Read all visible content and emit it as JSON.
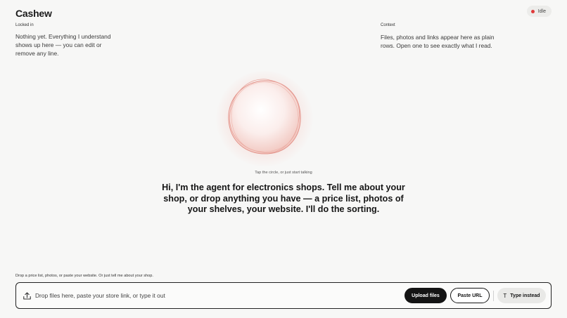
{
  "app": {
    "name": "Cashew"
  },
  "status": {
    "label": "Idle",
    "dot_color": "#e03a3a"
  },
  "locked_in": {
    "label": "Locked in",
    "text": "Nothing yet. Everything I understand shows up here — you can edit or remove any line."
  },
  "context": {
    "label": "Context",
    "text": "Files, photos and links appear here as plain rows. Open one to see exactly what I read."
  },
  "orb": {
    "icon": "voice-orb-icon",
    "accent": "#e8a39a"
  },
  "hint": "Tap the circle, or just start talking",
  "headline": "Hi, I'm the agent for electronics shops. Tell me about your shop, or drop anything you have — a price list, photos of your shelves, your website. I'll do the sorting.",
  "composer": {
    "label": "Drop a price list, photos, or paste your website. Or just tell me about your shop.",
    "placeholder": "Drop files here, paste your store link, or type it out",
    "upload_icon": "upload-icon",
    "upload_label": "Upload files",
    "paste_label": "Paste URL",
    "type_icon": "text-icon",
    "type_glyph": "T",
    "type_label": "Type instead"
  }
}
